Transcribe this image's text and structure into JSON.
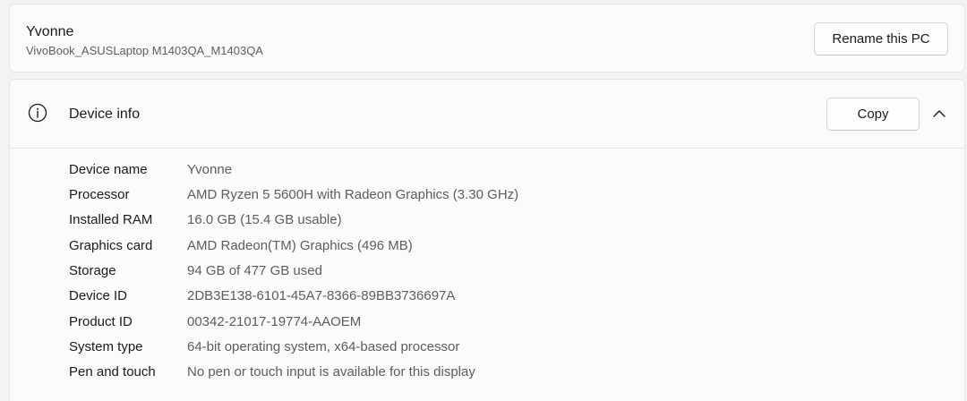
{
  "pc": {
    "name": "Yvonne",
    "model": "VivoBook_ASUSLaptop M1403QA_M1403QA",
    "rename_label": "Rename this PC"
  },
  "device_info": {
    "title": "Device info",
    "copy_label": "Copy",
    "icons": {
      "section": "info-icon",
      "toggle": "chevron-up-icon"
    },
    "specs": [
      {
        "label": "Device name",
        "value": "Yvonne"
      },
      {
        "label": "Processor",
        "value": "AMD Ryzen 5 5600H with Radeon Graphics (3.30 GHz)"
      },
      {
        "label": "Installed RAM",
        "value": "16.0 GB (15.4 GB usable)"
      },
      {
        "label": "Graphics card",
        "value": "AMD Radeon(TM) Graphics (496 MB)"
      },
      {
        "label": "Storage",
        "value": "94 GB of 477 GB used"
      },
      {
        "label": "Device ID",
        "value": "2DB3E138-6101-45A7-8366-89BB3736697A"
      },
      {
        "label": "Product ID",
        "value": "00342-21017-19774-AAOEM"
      },
      {
        "label": "System type",
        "value": "64-bit operating system, x64-based processor"
      },
      {
        "label": "Pen and touch",
        "value": "No pen or touch input is available for this display"
      }
    ]
  }
}
